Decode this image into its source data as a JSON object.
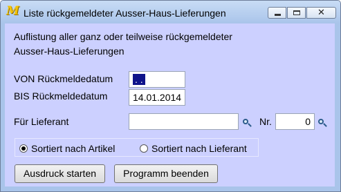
{
  "window": {
    "title": "Liste rückgemeldeter Ausser-Haus-Lieferungen",
    "icon": "M",
    "controls": {
      "minimize": "minimize-icon",
      "maximize": "maximize-icon",
      "close": "✕"
    }
  },
  "intro": {
    "line1": "Auflistung aller ganz oder teilweise rückgemeldeter",
    "line2": "Ausser-Haus-Lieferungen"
  },
  "von": {
    "label": "VON Rückmeldedatum",
    "value": " .  . "
  },
  "bis": {
    "label": "BIS Rückmeldedatum",
    "value": "14.01.2014"
  },
  "lieferant": {
    "label": "Für Lieferant",
    "value": ""
  },
  "nr": {
    "label": "Nr.",
    "value": "0"
  },
  "sort": {
    "option_artikel": "Sortiert nach Artikel",
    "option_lieferant": "Sortiert nach Lieferant",
    "selected": "artikel"
  },
  "buttons": {
    "print": "Ausdruck starten",
    "exit": "Programm beenden"
  }
}
